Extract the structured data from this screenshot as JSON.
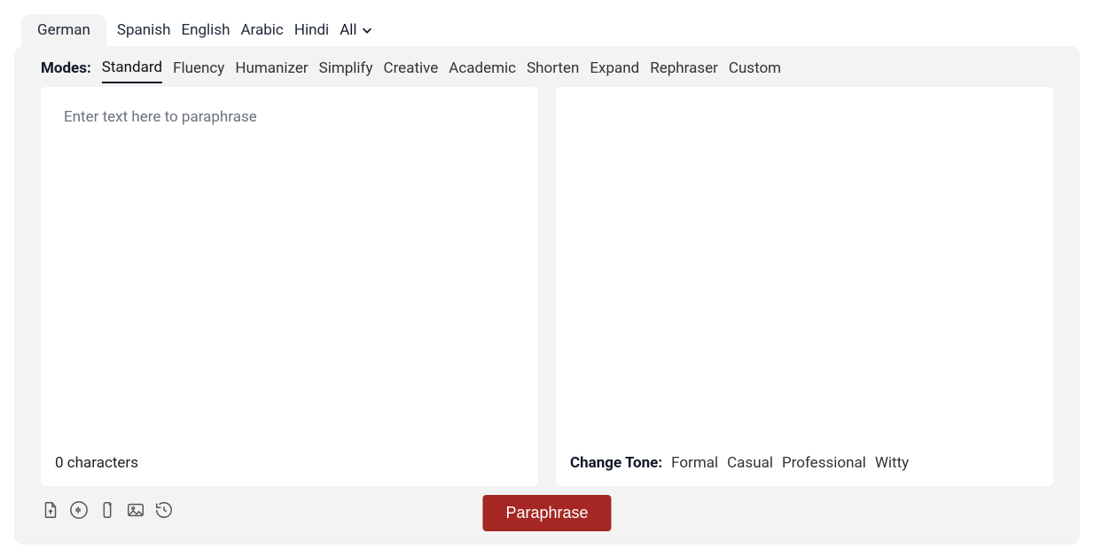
{
  "languages": {
    "items": [
      "German",
      "Spanish",
      "English",
      "Arabic",
      "Hindi"
    ],
    "all_label": "All"
  },
  "modes": {
    "label": "Modes:",
    "items": [
      "Standard",
      "Fluency",
      "Humanizer",
      "Simplify",
      "Creative",
      "Academic",
      "Shorten",
      "Expand",
      "Rephraser",
      "Custom"
    ]
  },
  "input": {
    "placeholder": "Enter text here to paraphrase",
    "char_count": "0 characters"
  },
  "output": {
    "tone_label": "Change Tone:",
    "tones": [
      "Formal",
      "Casual",
      "Professional",
      "Witty"
    ]
  },
  "action": {
    "paraphrase_label": "Paraphrase"
  }
}
